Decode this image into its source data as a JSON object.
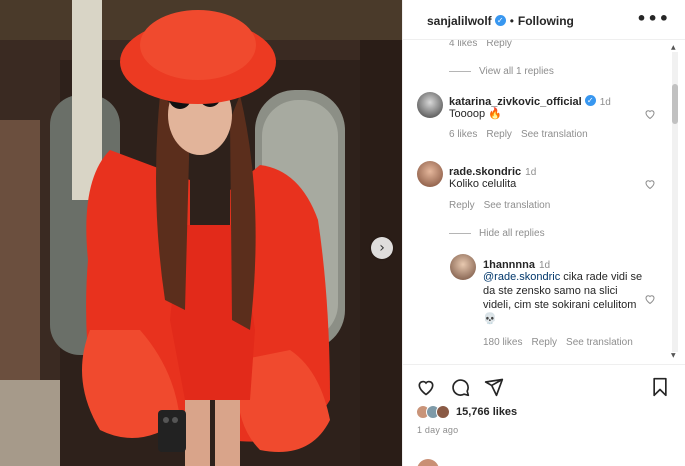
{
  "post": {
    "author": "sanjalilwolf",
    "follow_status": "Following",
    "more_label": "•••",
    "next_label": "›"
  },
  "comments": {
    "prev_meta": {
      "likes": "4 likes",
      "reply": "Reply"
    },
    "view_replies": "View all 1 replies",
    "items": [
      {
        "user": "katarina_zivkovic_official",
        "time": "1d",
        "text": "Toooop 🔥",
        "likes": "6 likes",
        "reply": "Reply",
        "translate": "See translation"
      },
      {
        "user": "rade.skondric",
        "time": "1d",
        "text": "Koliko celulita",
        "reply": "Reply",
        "translate": "See translation"
      }
    ],
    "hide_replies": "Hide all replies",
    "reply": {
      "user": "1hannnna",
      "time": "1d",
      "mention": "@rade.skondric",
      "text": " cika rade vidi se da ste zensko samo na slici videli, cim ste sokirani celulitom 💀",
      "likes": "180 likes",
      "reply": "Reply",
      "translate": "See translation"
    }
  },
  "footer": {
    "likes": "15,766 likes",
    "ago": "1 day ago"
  },
  "colors": {
    "fur": "#e8321e",
    "verified": "#3897f0",
    "meta_grey": "#8e8e8e"
  }
}
